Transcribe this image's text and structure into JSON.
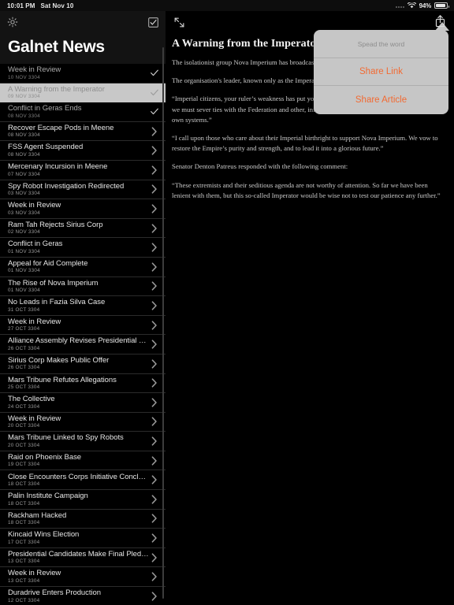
{
  "statusbar": {
    "time": "10:01 PM",
    "date": "Sat Nov 10",
    "battery_percent": "94%",
    "wifi_icon": "wifi-icon",
    "battery_icon": "battery-icon",
    "signal_icon": "signal-dots-icon"
  },
  "sidebar": {
    "title": "Galnet News",
    "settings_icon": "gear-icon",
    "markread_icon": "checkbox-check-icon",
    "items": [
      {
        "title": "Week in Review",
        "date": "10 NOV 3304",
        "accessory": "check",
        "state": "read"
      },
      {
        "title": "A Warning from the Imperator",
        "date": "09 NOV 3304",
        "accessory": "check",
        "state": "selected"
      },
      {
        "title": "Conflict in Geras Ends",
        "date": "08 NOV 3304",
        "accessory": "check",
        "state": "read"
      },
      {
        "title": "Recover Escape Pods in Meene",
        "date": "08 NOV 3304",
        "accessory": "chevron",
        "state": "unread"
      },
      {
        "title": "FSS Agent Suspended",
        "date": "08 NOV 3304",
        "accessory": "chevron",
        "state": "unread"
      },
      {
        "title": "Mercenary Incursion in Meene",
        "date": "07 NOV 3304",
        "accessory": "chevron",
        "state": "unread"
      },
      {
        "title": "Spy Robot Investigation Redirected",
        "date": "03 NOV 3304",
        "accessory": "chevron",
        "state": "unread"
      },
      {
        "title": "Week in Review",
        "date": "03 NOV 3304",
        "accessory": "chevron",
        "state": "unread"
      },
      {
        "title": "Ram Tah Rejects Sirius Corp",
        "date": "02 NOV 3304",
        "accessory": "chevron",
        "state": "unread"
      },
      {
        "title": "Conflict in Geras",
        "date": "01 NOV 3304",
        "accessory": "chevron",
        "state": "unread"
      },
      {
        "title": "Appeal for Aid Complete",
        "date": "01 NOV 3304",
        "accessory": "chevron",
        "state": "unread"
      },
      {
        "title": "The Rise of Nova Imperium",
        "date": "01 NOV 3304",
        "accessory": "chevron",
        "state": "unread"
      },
      {
        "title": "No Leads in Fazia Silva Case",
        "date": "31 OCT 3304",
        "accessory": "chevron",
        "state": "unread"
      },
      {
        "title": "Week in Review",
        "date": "27 OCT 3304",
        "accessory": "chevron",
        "state": "unread"
      },
      {
        "title": "Alliance Assembly Revises Presidential Role",
        "date": "26 OCT 3304",
        "accessory": "chevron",
        "state": "unread"
      },
      {
        "title": "Sirius Corp Makes Public Offer",
        "date": "26 OCT 3304",
        "accessory": "chevron",
        "state": "unread"
      },
      {
        "title": "Mars Tribune Refutes Allegations",
        "date": "25 OCT 3304",
        "accessory": "chevron",
        "state": "unread"
      },
      {
        "title": "The Collective",
        "date": "24 OCT 3304",
        "accessory": "chevron",
        "state": "unread"
      },
      {
        "title": "Week in Review",
        "date": "20 OCT 3304",
        "accessory": "chevron",
        "state": "unread"
      },
      {
        "title": "Mars Tribune Linked to Spy Robots",
        "date": "20 OCT 3304",
        "accessory": "chevron",
        "state": "unread"
      },
      {
        "title": "Raid on Phoenix Base",
        "date": "19 OCT 3304",
        "accessory": "chevron",
        "state": "unread"
      },
      {
        "title": "Close Encounters Corps Initiative Concludes",
        "date": "18 OCT 3304",
        "accessory": "chevron",
        "state": "unread"
      },
      {
        "title": "Palin Institute Campaign",
        "date": "18 OCT 3304",
        "accessory": "chevron",
        "state": "unread"
      },
      {
        "title": "Rackham Hacked",
        "date": "18 OCT 3304",
        "accessory": "chevron",
        "state": "unread"
      },
      {
        "title": "Kincaid Wins Election",
        "date": "17 OCT 3304",
        "accessory": "chevron",
        "state": "unread"
      },
      {
        "title": "Presidential Candidates Make Final Pledges",
        "date": "13 OCT 3304",
        "accessory": "chevron",
        "state": "unread"
      },
      {
        "title": "Week in Review",
        "date": "13 OCT 3304",
        "accessory": "chevron",
        "state": "unread"
      },
      {
        "title": "Duradrive Enters Production",
        "date": "12 OCT 3304",
        "accessory": "chevron",
        "state": "unread"
      }
    ]
  },
  "detail": {
    "expand_icon": "expand-arrows-icon",
    "share_icon": "share-icon",
    "title": "A Warning from the Imperator",
    "paragraphs": [
      "The isolationist group Nova Imperium has broadcast a message via the Imperial media.",
      "The organisation's leader, known only as the Imperator, made this statement:",
      "“Imperial citizens, your ruler’s weakness has put you all at risk. To survive the Thargoid onslaught, we must sever ties with the Federation and other, inferior powers, and concentrate on protecting our own systems.”",
      "“I call upon those who care about their Imperial birthright to support Nova Imperium. We vow to restore the Empire’s purity and strength, and to lead it into a glorious future.”",
      "Senator Denton Patreus responded with the following comment:",
      "“These extremists and their seditious agenda are not worthy of attention. So far we have been lenient with them, but this so-called Imperator would be wise not to test our patience any further.”"
    ]
  },
  "popover": {
    "header": "Spead the word",
    "items": [
      {
        "label": "Share Link"
      },
      {
        "label": "Share Article"
      }
    ],
    "accent_color": "#f26a32",
    "background_color": "#c6c6c6"
  }
}
